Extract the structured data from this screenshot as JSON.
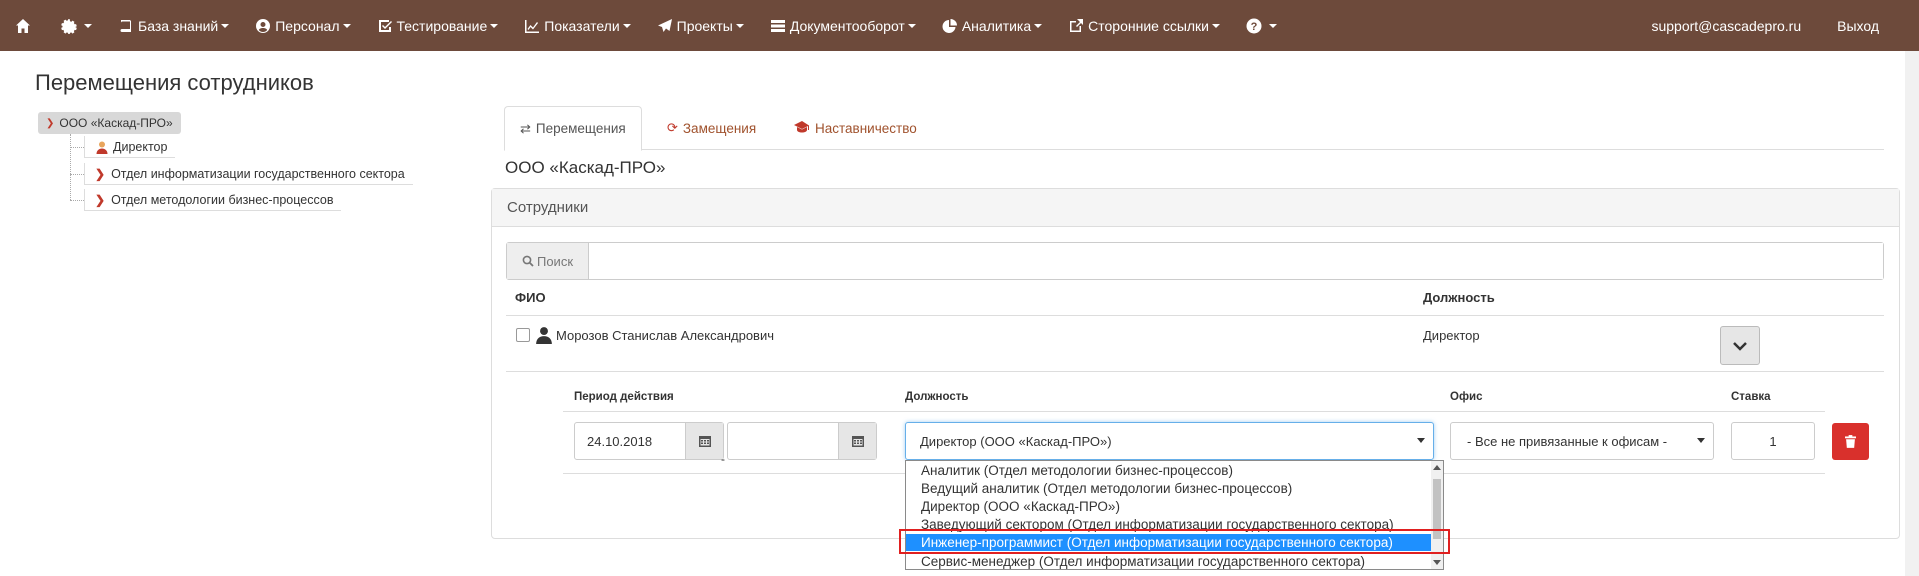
{
  "navbar": {
    "items": [
      {
        "label": "",
        "icon": "home-icon"
      },
      {
        "label": "",
        "icon": "gear-icon"
      },
      {
        "label": "База знаний",
        "icon": "book-icon"
      },
      {
        "label": "Персонал",
        "icon": "user-circle-icon"
      },
      {
        "label": "Тестирование",
        "icon": "checkbox-icon"
      },
      {
        "label": "Показатели",
        "icon": "line-chart-icon"
      },
      {
        "label": "Проекты",
        "icon": "paper-plane-icon"
      },
      {
        "label": "Документооборот",
        "icon": "server-icon"
      },
      {
        "label": "Аналитика",
        "icon": "pie-chart-icon"
      },
      {
        "label": "Сторонние ссылки",
        "icon": "external-link-icon"
      },
      {
        "label": "",
        "icon": "question-icon"
      }
    ],
    "user_email": "support@cascadepro.ru",
    "logout": "Выход",
    "bg_color": "#6d4a3b"
  },
  "page": {
    "title": "Перемещения сотрудников"
  },
  "tree": {
    "root": "ООО «Каскад-ПРО»",
    "nodes": [
      {
        "label": "Директор",
        "type": "person"
      },
      {
        "label": "Отдел информатизации государственного сектора",
        "type": "dept"
      },
      {
        "label": "Отдел методологии бизнес-процессов",
        "type": "dept"
      }
    ]
  },
  "tabs": [
    {
      "label": "Перемещения",
      "icon": "exchange-icon",
      "active": true
    },
    {
      "label": "Замещения",
      "icon": "refresh-icon",
      "active": false
    },
    {
      "label": "Наставничество",
      "icon": "graduation-cap-icon",
      "active": false
    }
  ],
  "org_title": "ООО «Каскад-ПРО»",
  "panel": {
    "title": "Сотрудники",
    "search_label": "Поиск",
    "search_value": "",
    "columns": {
      "name": "ФИО",
      "position": "Должность"
    },
    "employee": {
      "name": "Морозов Станислав Александрович",
      "position": "Директор"
    },
    "sub_columns": {
      "period": "Период действия",
      "position": "Должность",
      "office": "Офис",
      "rate": "Ставка"
    },
    "form": {
      "date_from": "24.10.2018",
      "date_sep": "-",
      "date_to": "",
      "position_selected": "Директор (ООО «Каскад-ПРО»)",
      "office_selected": "- Все не привязанные к офисам -",
      "rate": "1"
    },
    "position_options": [
      "Аналитик (Отдел методологии бизнес-процессов)",
      "Ведущий аналитик (Отдел методологии бизнес-процессов)",
      "Директор (ООО «Каскад-ПРО»)",
      "Заведующий сектором (Отдел информатизации государственного сектора)",
      "Инженер-программист (Отдел информатизации государственного сектора)",
      "Сервис-менеджер (Отдел информатизации государственного сектора)"
    ],
    "highlighted_option_index": 4
  },
  "colors": {
    "accent_link": "#a0522d",
    "danger": "#d9302c",
    "selection": "#1e90ff"
  }
}
